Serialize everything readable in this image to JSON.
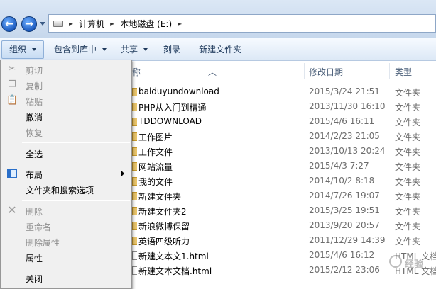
{
  "breadcrumb": {
    "items": [
      "计算机",
      "本地磁盘 (E:)"
    ],
    "separator": "►"
  },
  "nav": {
    "back_glyph": "←",
    "forward_glyph": "→"
  },
  "toolbar": {
    "organize": "组织",
    "include_in_library": "包含到库中",
    "share": "共享",
    "burn": "刻录",
    "new_folder": "新建文件夹"
  },
  "columns": {
    "name": "称",
    "date": "修改日期",
    "type": "类型"
  },
  "files": [
    {
      "name": "baiduyundownload",
      "date": "2015/3/24 21:51",
      "type": "文件夹",
      "icon": "folder"
    },
    {
      "name": "PHP从入门到精通",
      "date": "2013/11/30 16:10",
      "type": "文件夹",
      "icon": "folder"
    },
    {
      "name": "TDDOWNLOAD",
      "date": "2015/4/6 16:11",
      "type": "文件夹",
      "icon": "folder"
    },
    {
      "name": "工作图片",
      "date": "2014/2/23 21:05",
      "type": "文件夹",
      "icon": "folder"
    },
    {
      "name": "工作文件",
      "date": "2013/10/13 20:24",
      "type": "文件夹",
      "icon": "folder"
    },
    {
      "name": "网站流量",
      "date": "2015/4/3 7:27",
      "type": "文件夹",
      "icon": "folder"
    },
    {
      "name": "我的文件",
      "date": "2014/10/2 8:18",
      "type": "文件夹",
      "icon": "folder"
    },
    {
      "name": "新建文件夹",
      "date": "2014/7/26 19:07",
      "type": "文件夹",
      "icon": "folder"
    },
    {
      "name": "新建文件夹2",
      "date": "2015/3/25 19:51",
      "type": "文件夹",
      "icon": "folder"
    },
    {
      "name": "新浪微博保留",
      "date": "2013/9/20 20:57",
      "type": "文件夹",
      "icon": "folder"
    },
    {
      "name": "英语四级听力",
      "date": "2011/12/29 14:39",
      "type": "文件夹",
      "icon": "folder"
    },
    {
      "name": "新建文本文1.html",
      "date": "2015/4/6 16:12",
      "type": "HTML 文档",
      "icon": "doc"
    },
    {
      "name": "新建文本文档.html",
      "date": "2015/2/12 23:06",
      "type": "HTML 文档",
      "icon": "doc"
    }
  ],
  "menu": {
    "cut": "剪切",
    "copy": "复制",
    "paste": "粘贴",
    "undo": "撤消",
    "redo": "恢复",
    "select_all": "全选",
    "layout": "布局",
    "folder_options": "文件夹和搜索选项",
    "delete": "删除",
    "rename": "重命名",
    "remove_properties": "删除属性",
    "properties": "属性",
    "close": "关闭"
  },
  "icons": {
    "cut": "scissors-icon",
    "copy": "copy-icon",
    "paste": "paste-icon",
    "layout": "layout-icon",
    "delete": "delete-x-icon",
    "folder": "folder-icon",
    "doc": "html-document-icon",
    "drive": "drive-icon"
  },
  "watermark": {
    "text": "经验"
  }
}
